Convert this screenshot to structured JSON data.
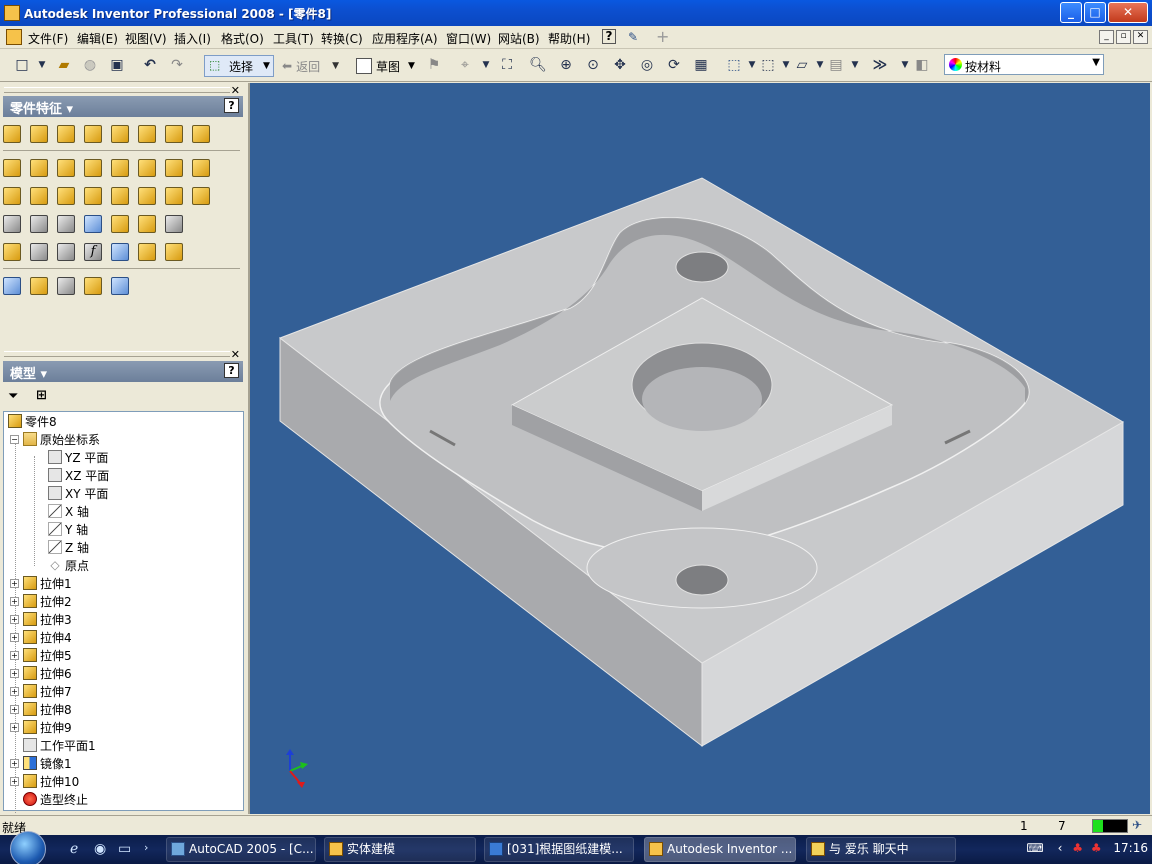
{
  "window": {
    "title": "Autodesk Inventor Professional 2008 - [零件8]",
    "controls": [
      "_",
      "□",
      "✕"
    ]
  },
  "menu": {
    "items": [
      "文件(F)",
      "编辑(E)",
      "视图(V)",
      "插入(I)",
      "格式(O)",
      "工具(T)",
      "转换(C)",
      "应用程序(A)",
      "窗口(W)",
      "网站(B)",
      "帮助(H)"
    ],
    "mdi_controls": [
      "_",
      "▫",
      "✕"
    ]
  },
  "toolbar": {
    "select_label": "选择",
    "back_label": "返回",
    "sketch_label": "草图",
    "material_combo": "按材料"
  },
  "features_panel": {
    "title": "零件特征 ▾",
    "help": "?",
    "close": "✕"
  },
  "model_panel": {
    "title": "模型 ▾",
    "help": "?",
    "close": "✕"
  },
  "browser": {
    "root": "零件8",
    "origin_folder": "原始坐标系",
    "origin_items": [
      "YZ 平面",
      "XZ 平面",
      "XY 平面",
      "X 轴",
      "Y 轴",
      "Z 轴",
      "原点"
    ],
    "features": [
      "拉伸1",
      "拉伸2",
      "拉伸3",
      "拉伸4",
      "拉伸5",
      "拉伸6",
      "拉伸7",
      "拉伸8",
      "拉伸9",
      "工作平面1",
      "镜像1",
      "拉伸10",
      "造型终止"
    ]
  },
  "status": {
    "text": "就绪",
    "num1": "1",
    "num2": "7",
    "meter_fraction": 0.3
  },
  "taskbar": {
    "tasks": [
      "AutoCAD 2005 - [C...",
      "实体建模",
      "[031]根据图纸建模...",
      "Autodesk Inventor ...",
      "与 爱乐 聊天中"
    ],
    "clock": "17:16"
  },
  "colors": {
    "viewport_bg": "#335f96",
    "part_top": "#c8c9cb",
    "part_left": "#a9aaad",
    "part_right": "#d6d7d9"
  }
}
